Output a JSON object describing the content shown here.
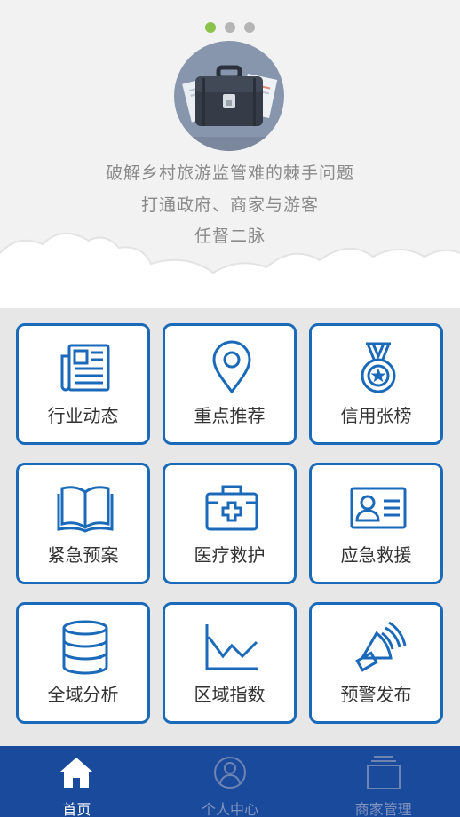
{
  "banner": {
    "carousel_dots": 3,
    "active_dot": 0,
    "line1": "破解乡村旅游监管难的棘手问题",
    "line2": "打通政府、商家与游客",
    "line3": "任督二脉"
  },
  "grid": {
    "items": [
      {
        "label": "行业动态",
        "icon": "newspaper-icon"
      },
      {
        "label": "重点推荐",
        "icon": "location-pin-icon"
      },
      {
        "label": "信用张榜",
        "icon": "medal-icon"
      },
      {
        "label": "紧急预案",
        "icon": "book-icon"
      },
      {
        "label": "医疗救护",
        "icon": "first-aid-kit-icon"
      },
      {
        "label": "应急救援",
        "icon": "id-card-icon"
      },
      {
        "label": "全域分析",
        "icon": "database-icon"
      },
      {
        "label": "区域指数",
        "icon": "line-chart-icon"
      },
      {
        "label": "预警发布",
        "icon": "speaker-icon"
      }
    ]
  },
  "tabbar": {
    "items": [
      {
        "label": "首页",
        "icon": "home-icon",
        "active": true
      },
      {
        "label": "个人中心",
        "icon": "user-icon",
        "active": false
      },
      {
        "label": "商家管理",
        "icon": "folder-icon",
        "active": false
      }
    ]
  },
  "colors": {
    "accent": "#1a6ab9",
    "tabbar": "#1a4a9c",
    "grid_bg": "#e7e7e7",
    "dot_active": "#8bc34a"
  }
}
